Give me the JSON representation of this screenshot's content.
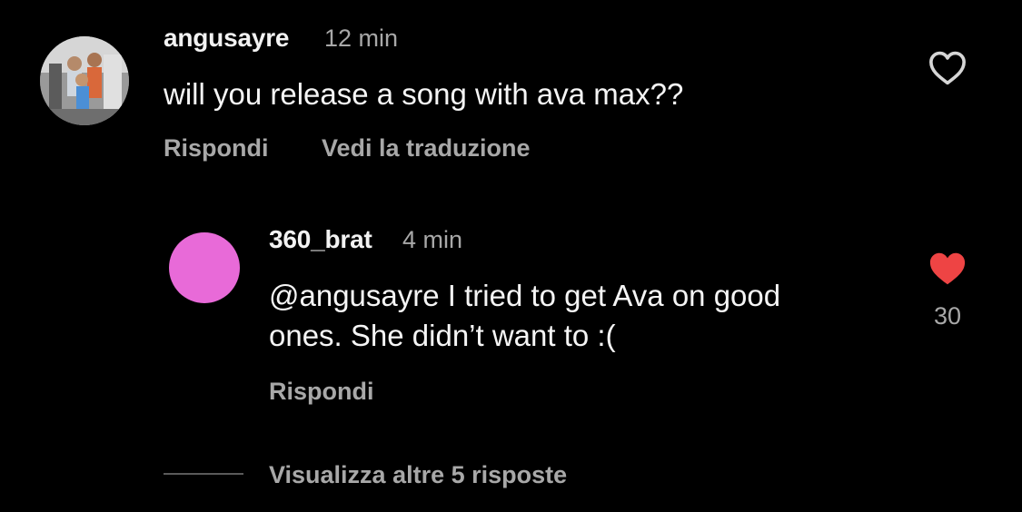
{
  "comments": [
    {
      "username": "angusayre",
      "time": "12 min",
      "text": "will you release a song with ava max??",
      "actions": {
        "reply": "Rispondi",
        "translate": "Vedi la traduzione"
      },
      "liked": false
    }
  ],
  "reply": {
    "username": "360_brat",
    "time": "4 min",
    "text_line1": "@angusayre I tried to get Ava on good",
    "text_line2": "ones. She didn’t want to :(",
    "actions": {
      "reply": "Rispondi"
    },
    "liked": true,
    "like_count": "30",
    "avatar_color": "#e86ad8"
  },
  "more_replies": "Visualizza altre 5 risposte",
  "colors": {
    "background": "#000000",
    "secondary_text": "#a8a8a8",
    "heart_liked": "#ee4444"
  },
  "icons": {
    "heart_outline": "heart-outline-icon",
    "heart_filled": "heart-filled-icon"
  }
}
